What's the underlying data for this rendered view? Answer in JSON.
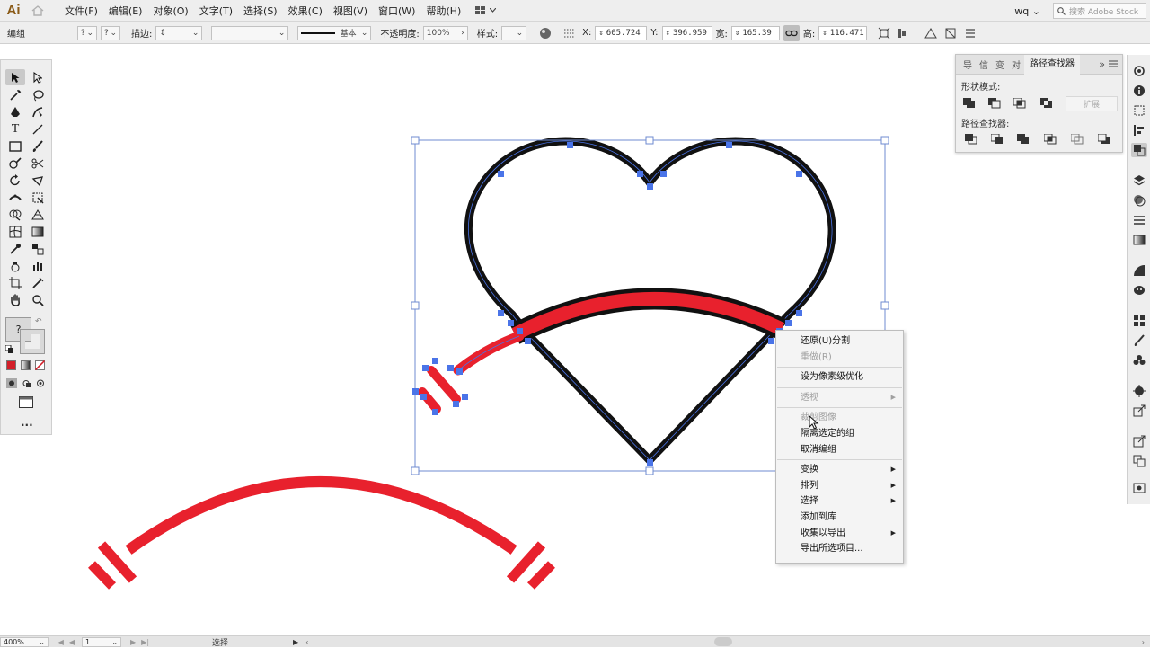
{
  "app": {
    "logo": "Ai"
  },
  "menu": [
    "文件(F)",
    "编辑(E)",
    "对象(O)",
    "文字(T)",
    "选择(S)",
    "效果(C)",
    "视图(V)",
    "窗口(W)",
    "帮助(H)"
  ],
  "user": {
    "name": "wq"
  },
  "stock_search": {
    "placeholder": "搜索 Adobe Stock"
  },
  "control": {
    "selection": "编组",
    "stroke_label": "描边:",
    "stroke_style": "基本",
    "opacity_label": "不透明度:",
    "opacity_value": "100%",
    "style_label": "样式:",
    "x_label": "X:",
    "x_value": "605.724",
    "y_label": "Y:",
    "y_value": "396.959",
    "w_label": "宽:",
    "w_value": "165.39",
    "h_label": "高:",
    "h_value": "116.471",
    "unknown": "?"
  },
  "pathfinder_panel": {
    "tabs": [
      "导",
      "信",
      "变",
      "对",
      "路径查找器"
    ],
    "shape_modes_label": "形状模式:",
    "expand_label": "扩展",
    "pathfinders_label": "路径查找器:"
  },
  "context_menu": {
    "items": [
      {
        "label": "还原(U)分割",
        "disabled": false,
        "submenu": false
      },
      {
        "label": "重做(R)",
        "disabled": true,
        "submenu": false
      },
      {
        "sep": true
      },
      {
        "label": "设为像素级优化",
        "disabled": false,
        "submenu": false
      },
      {
        "sep": true
      },
      {
        "label": "透视",
        "disabled": true,
        "submenu": true
      },
      {
        "sep": true
      },
      {
        "label": "裁剪图像",
        "disabled": true,
        "submenu": false
      },
      {
        "label": "隔离选定的组",
        "disabled": false,
        "submenu": false
      },
      {
        "label": "取消编组",
        "disabled": false,
        "submenu": false
      },
      {
        "sep": true
      },
      {
        "label": "变换",
        "disabled": false,
        "submenu": true
      },
      {
        "label": "排列",
        "disabled": false,
        "submenu": true
      },
      {
        "label": "选择",
        "disabled": false,
        "submenu": true
      },
      {
        "label": "添加到库",
        "disabled": false,
        "submenu": false
      },
      {
        "label": "收集以导出",
        "disabled": false,
        "submenu": true
      },
      {
        "label": "导出所选项目...",
        "disabled": false,
        "submenu": false
      }
    ]
  },
  "status": {
    "zoom": "400%",
    "artboard": "1",
    "tool": "选择"
  },
  "toolbox": {
    "unknown": "?",
    "more": "..."
  },
  "colors": {
    "red": "#e8212d",
    "black": "#111111",
    "anchor": "#4a74e8",
    "bbox": "#6f8bd1",
    "logo": "#8a5a17"
  }
}
